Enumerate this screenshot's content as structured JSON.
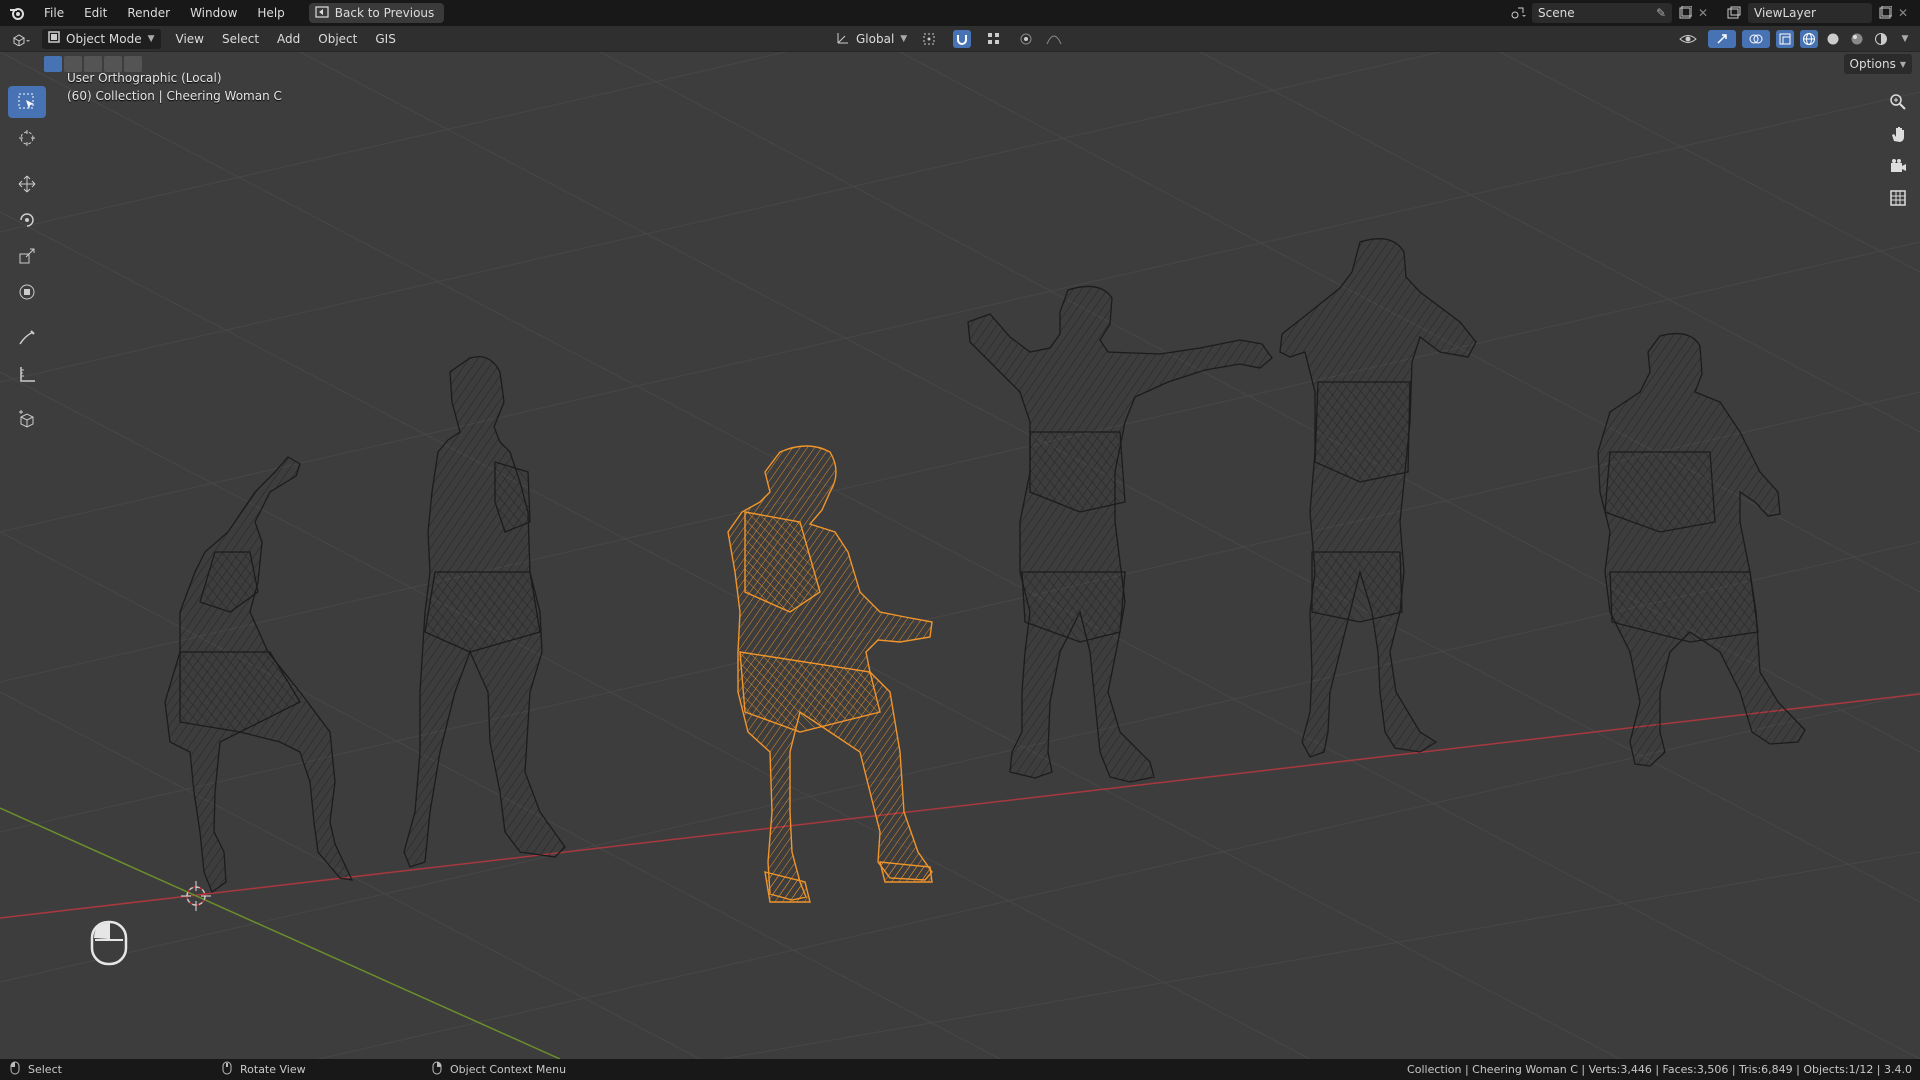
{
  "menu": [
    "File",
    "Edit",
    "Render",
    "Window",
    "Help"
  ],
  "back_button": "Back to Previous",
  "scene": {
    "label": "Scene",
    "view_layer": "ViewLayer"
  },
  "header": {
    "mode": "Object Mode",
    "menus": [
      "View",
      "Select",
      "Add",
      "Object",
      "GIS"
    ],
    "orientation": "Global",
    "options": "Options"
  },
  "viewport": {
    "view_name": "User Orthographic (Local)",
    "collection_info": "(60) Collection | Cheering Woman C"
  },
  "status": {
    "left_items": [
      "Select",
      "Rotate View",
      "Object Context Menu"
    ],
    "stats": "Collection | Cheering Woman C | Verts:3,446 | Faces:3,506 | Tris:6,849 | Objects:1/12 | 3.4.0"
  },
  "colors": {
    "selected": "#f0952b",
    "wire": "#1a1a1a",
    "x_axis": "#a8383f",
    "y_axis": "#6b8f2c",
    "accent": "#4772b3"
  }
}
